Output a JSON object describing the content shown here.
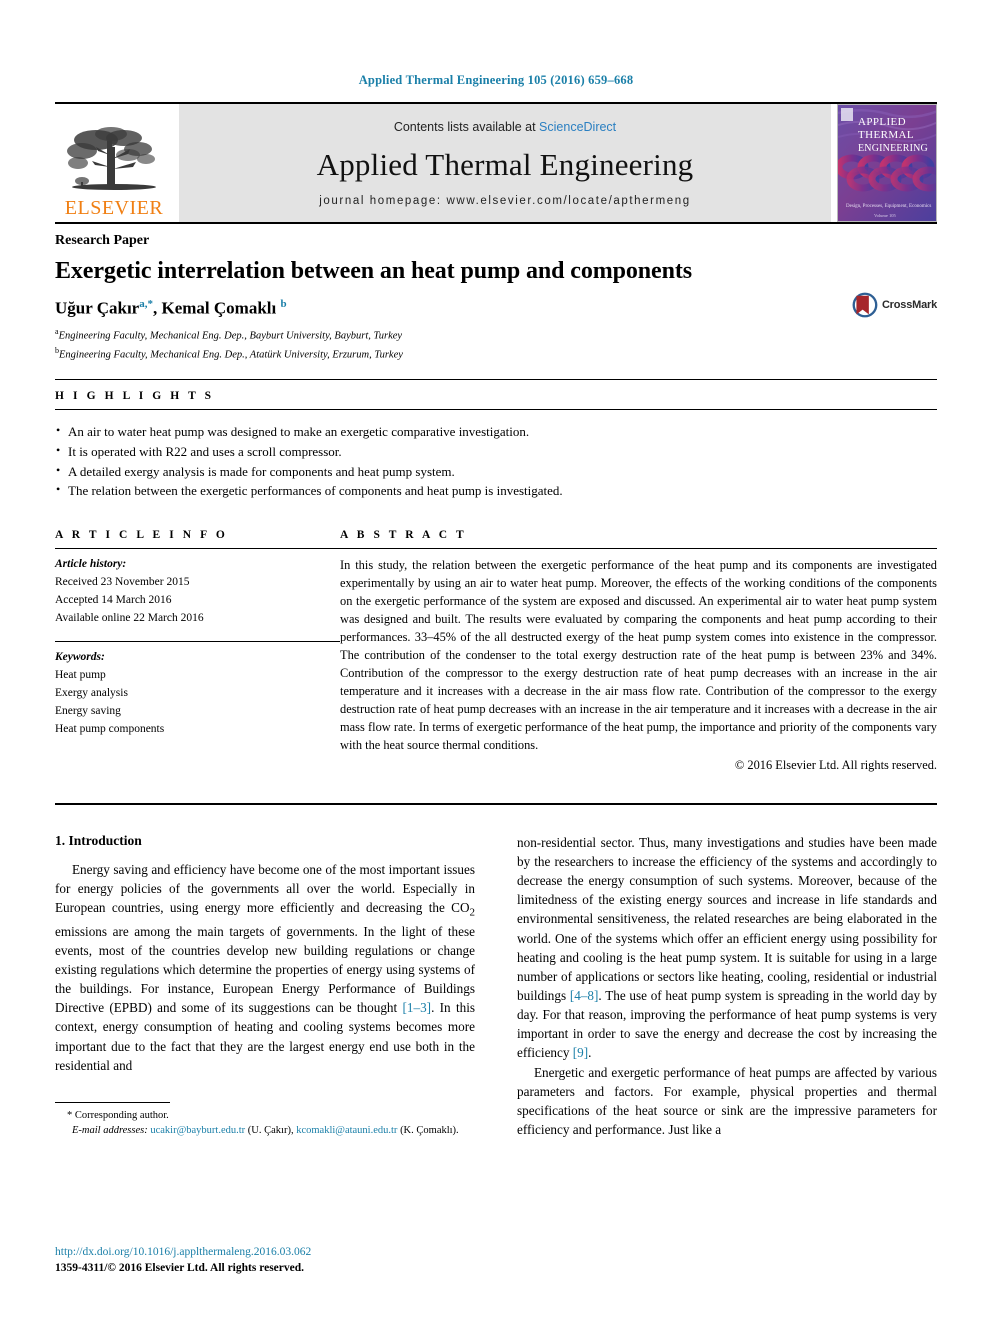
{
  "running_head": "Applied Thermal Engineering 105 (2016) 659–668",
  "masthead": {
    "publisher": "ELSEVIER",
    "contents_prefix": "Contents lists available at ",
    "contents_link": "ScienceDirect",
    "journal_title": "Applied Thermal Engineering",
    "homepage": "journal homepage: www.elsevier.com/locate/apthermeng",
    "cover": {
      "line1": "APPLIED",
      "line2": "THERMAL",
      "line3": "ENGINEERING",
      "footer": "Design, Processes, Equipment, Economics",
      "bg": "#5b4a9e",
      "accent": "#b5357a"
    }
  },
  "article": {
    "kind": "Research Paper",
    "title": "Exergetic interrelation between an heat pump and components",
    "authors_html": "Uğur Çakır",
    "author1": "Uğur Çakır",
    "author1_sup": "a,*",
    "author2": "Kemal Çomaklı",
    "author2_sup": "b",
    "affiliation_a_sup": "a",
    "affiliation_a": "Engineering Faculty, Mechanical Eng. Dep., Bayburt University, Bayburt, Turkey",
    "affiliation_b_sup": "b",
    "affiliation_b": "Engineering Faculty, Mechanical Eng. Dep., Atatürk University, Erzurum, Turkey",
    "crossmark_label": "CrossMark"
  },
  "highlights": {
    "heading": "H I G H L I G H T S",
    "items": [
      "An air to water heat pump was designed to make an exergetic comparative investigation.",
      "It is operated with R22 and uses a scroll compressor.",
      "A detailed exergy analysis is made for components and heat pump system.",
      "The relation between the exergetic performances of components and heat pump is investigated."
    ]
  },
  "article_info": {
    "heading": "A R T I C L E    I N F O",
    "history_label": "Article history:",
    "history": [
      "Received 23 November 2015",
      "Accepted 14 March 2016",
      "Available online 22 March 2016"
    ],
    "keywords_label": "Keywords:",
    "keywords": [
      "Heat pump",
      "Exergy analysis",
      "Energy saving",
      "Heat pump components"
    ]
  },
  "abstract": {
    "heading": "A B S T R A C T",
    "text": "In this study, the relation between the exergetic performance of the heat pump and its components are investigated experimentally by using an air to water heat pump. Moreover, the effects of the working conditions of the components on the exergetic performance of the system are exposed and discussed. An experimental air to water heat pump system was designed and built. The results were evaluated by comparing the components and heat pump according to their performances. 33–45% of the all destructed exergy of the heat pump system comes into existence in the compressor. The contribution of the condenser to the total exergy destruction rate of the heat pump is between 23% and 34%. Contribution of the compressor to the exergy destruction rate of heat pump decreases with an increase in the air temperature and it increases with a decrease in the air mass flow rate. Contribution of the compressor to the exergy destruction rate of heat pump decreases with an increase in the air temperature and it increases with a decrease in the air mass flow rate. In terms of exergetic performance of the heat pump, the importance and priority of the components vary with the heat source thermal conditions.",
    "copyright": "© 2016 Elsevier Ltd. All rights reserved."
  },
  "body": {
    "section_number_title": "1. Introduction",
    "left_paragraph_1_part1": "Energy saving and efficiency have become one of the most important issues for energy policies of the governments all over the world. Especially in European countries, using energy more efficiently and decreasing the CO",
    "left_paragraph_1_sub": "2",
    "left_paragraph_1_part2": " emissions are among the main targets of governments. In the light of these events, most of the countries develop new building regulations or change existing regulations which determine the properties of energy using systems of the buildings. For instance, European Energy Performance of Buildings Directive (EPBD) and some of its suggestions can be thought ",
    "ref_1_3": "[1–3]",
    "left_paragraph_1_part3": ". In this context, energy consumption of heating and cooling systems becomes more important due to the fact that they are the largest energy end use both in the residential and",
    "right_paragraph_1": "non-residential sector. Thus, many investigations and studies have been made by the researchers to increase the efficiency of the systems and accordingly to decrease the energy consumption of such systems. Moreover, because of the limitedness of the existing energy sources and increase in life standards and environmental sensitiveness, the related researches are being elaborated in the world. One of the systems which offer an efficient energy using possibility for heating and cooling is the heat pump system. It is suitable for using in a large number of applications or sectors like heating, cooling, residential or industrial buildings ",
    "ref_4_8": "[4–8]",
    "right_paragraph_1_part2": ". The use of heat pump system is spreading in the world day by day. For that reason, improving the performance of heat pump systems is very important in order to save the energy and decrease the cost by increasing the efficiency ",
    "ref_9": "[9]",
    "right_paragraph_1_part3": ".",
    "right_paragraph_2": "Energetic and exergetic performance of heat pumps are affected by various parameters and factors. For example, physical properties and thermal specifications of the heat source or sink are the impressive parameters for efficiency and performance. Just like a"
  },
  "footnote": {
    "corresponding_marker": "*",
    "corresponding_text": "Corresponding author.",
    "email_label": "E-mail addresses:",
    "email1": "ucakir@bayburt.edu.tr",
    "email1_owner": "(U. Çakır),",
    "email2": "kcomakli@atauni.edu.tr",
    "email2_owner": "(K. Çomaklı)."
  },
  "footer": {
    "doi": "http://dx.doi.org/10.1016/j.applthermaleng.2016.03.062",
    "issn": "1359-4311/© 2016 Elsevier Ltd. All rights reserved."
  },
  "colors": {
    "link": "#1a7fa8",
    "sciencedirect": "#2a7fc1",
    "elsevier_orange": "#f07f13",
    "band_gray": "#e3e3e3"
  }
}
